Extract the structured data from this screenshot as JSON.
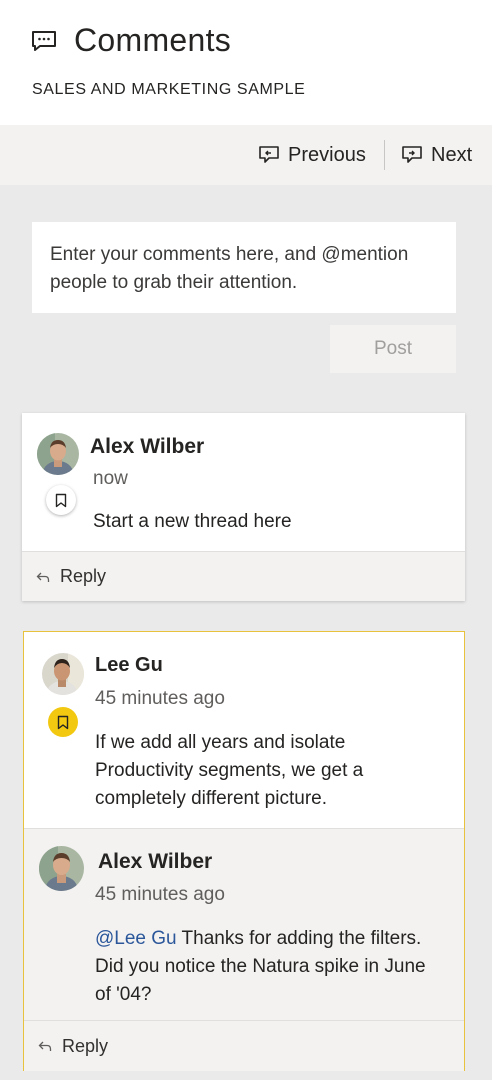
{
  "header": {
    "title": "Comments",
    "subtitle": "SALES AND MARKETING SAMPLE",
    "icon": "comment-icon"
  },
  "nav": {
    "previous_label": "Previous",
    "next_label": "Next"
  },
  "composer": {
    "placeholder": "Enter your comments here, and @mention people to grab their attention.",
    "post_label": "Post"
  },
  "threads": [
    {
      "author": "Alex Wilber",
      "time": "now",
      "text": "Start a new thread here",
      "reply_label": "Reply"
    },
    {
      "author": "Lee Gu",
      "time": "45 minutes ago",
      "text": "If we add all years and isolate Productivity segments, we get a completely different picture.",
      "reply": {
        "author": "Alex Wilber",
        "time": "45 minutes ago",
        "mention": "@Lee Gu",
        "text": " Thanks for adding the filters. Did you notice the Natura spike in June of '04?"
      },
      "reply_label": "Reply"
    }
  ],
  "colors": {
    "accent": "#f2c811",
    "mention": "#2b579a",
    "panel_bg": "#eaeaea"
  }
}
